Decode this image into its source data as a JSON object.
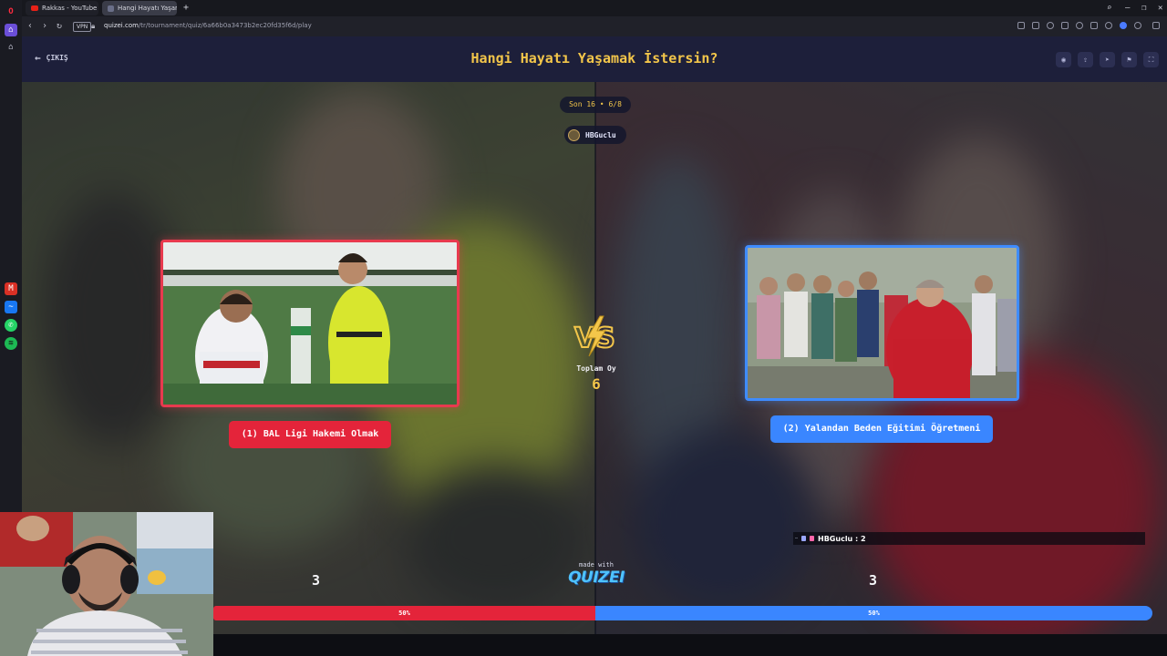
{
  "browser": {
    "tabs": [
      {
        "label": "Rakkas - YouTube"
      },
      {
        "label": "Hangi Hayatı Yaşamak İs..."
      }
    ],
    "new_tab_symbol": "+",
    "vpn_label": "VPN",
    "url_domain": "quizei.com",
    "url_path": "/tr/tournament/quiz/6a66b0a3473b2ec20fd35f6d/play"
  },
  "header": {
    "exit_label": "ÇIKIŞ",
    "title": "Hangi Hayatı Yaşamak İstersin?",
    "tools": [
      "eye-icon",
      "share-icon",
      "send-icon",
      "flag-icon",
      "fullscreen-icon"
    ]
  },
  "round": {
    "label": "Son 16 • 6/8"
  },
  "creator": {
    "name": "HBGuclu"
  },
  "options": {
    "left": {
      "label": "(1) BAL Ligi Hakemi Olmak",
      "votes": "3",
      "percent": "50%",
      "share": 0.5,
      "color": "#e4243a"
    },
    "right": {
      "label": "(2) Yalandan Beden Eğitimi Öğretmeni",
      "votes": "3",
      "percent": "50%",
      "share": 0.5,
      "color": "#3a86ff"
    }
  },
  "versus": {
    "total_label": "Toplam Oy",
    "total_votes": "6"
  },
  "chat_overlay": {
    "message": "HBGuclu : 2"
  },
  "branding": {
    "made_with": "made with",
    "logo": "QUIZEI"
  },
  "colors": {
    "accent_gold": "#f3c64a",
    "left_red": "#e4243a",
    "right_blue": "#3a86ff",
    "page_bg": "#1d1f3a"
  }
}
